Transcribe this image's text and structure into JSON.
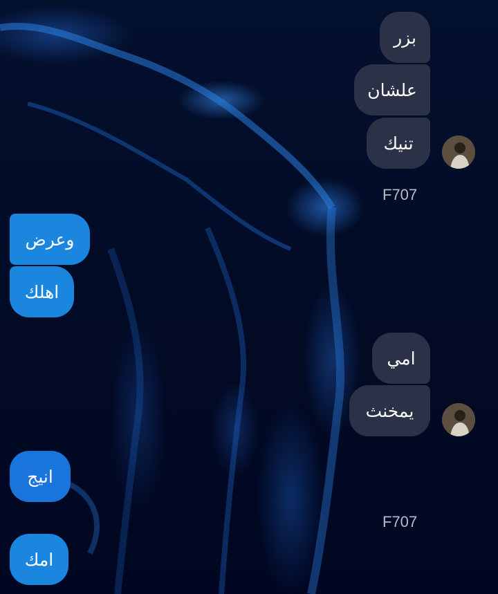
{
  "conversation": {
    "incoming_group_1": [
      "بزر",
      "علشان",
      "تنيك"
    ],
    "incoming_group_1_sender": "F707",
    "outgoing_group_1": [
      "وعرض",
      "اهلك"
    ],
    "incoming_group_2": [
      "امي",
      "يمخنث"
    ],
    "incoming_group_2_sender": "F707",
    "outgoing_group_2": [
      "انيج"
    ],
    "outgoing_group_3": [
      "امك"
    ]
  },
  "colors": {
    "incoming_bubble": "#2b3247",
    "outgoing_bubble": "#1a86de",
    "background": "#020a24"
  },
  "icons": {
    "avatar": "user-avatar-photo"
  }
}
